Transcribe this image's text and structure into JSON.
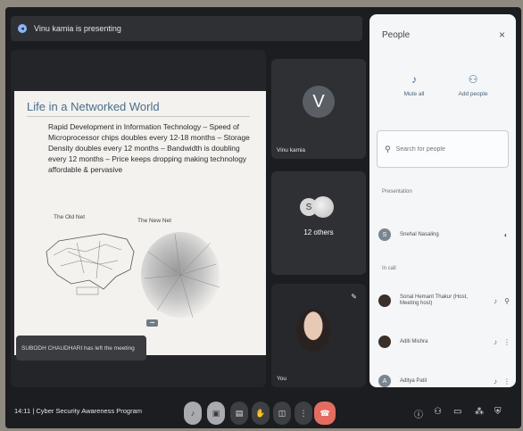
{
  "presenting_banner": "Vinu kamia is presenting",
  "slide": {
    "title": "Life in a Networked World",
    "body": "Rapid Development in Information Technology – Speed of Microprocessor chips doubles every 12-18 months – Storage Density doubles every 12 months – Bandwidth is doubling every 12 months – Price keeps dropping making technology affordable & pervasive",
    "old_net_label": "The Old Net",
    "new_net_label": "The New Net"
  },
  "left_note": "SUBODH CHAUDHARI has left the meeting",
  "tiles": {
    "tile1_initial": "V",
    "tile1_name": "Vinu kamia",
    "tile2_initial": "S",
    "tile2_count": "12 others",
    "tile3_name": "You"
  },
  "people_panel": {
    "title": "People",
    "close": "×",
    "mute_all": "Mute all",
    "add_people": "Add people",
    "search_placeholder": "Search for people",
    "section_presentation": "Presentation",
    "presenter_initial": "S",
    "presenter_name": "Snehal Nasaling",
    "section_meeting": "In call",
    "participants": [
      {
        "initial": "",
        "name": "Sonal Hemant Thakur (Host, Meeting host)"
      },
      {
        "initial": "",
        "name": "Aditi Mishra"
      },
      {
        "initial": "A",
        "name": "Aditya Patil"
      }
    ]
  },
  "bottom_bar": {
    "time": "14:11",
    "separator": "|",
    "meeting_name": "Cyber Security Awareness Program"
  },
  "icons": {
    "mic": "mic-icon",
    "camera": "camera-icon",
    "captions": "captions-icon",
    "hand": "raise-hand-icon",
    "present": "present-icon",
    "more": "more-icon",
    "end": "end-call-icon",
    "info": "info-icon",
    "people": "people-icon",
    "chat": "chat-icon",
    "activities": "activities-icon",
    "host": "host-controls-icon"
  }
}
